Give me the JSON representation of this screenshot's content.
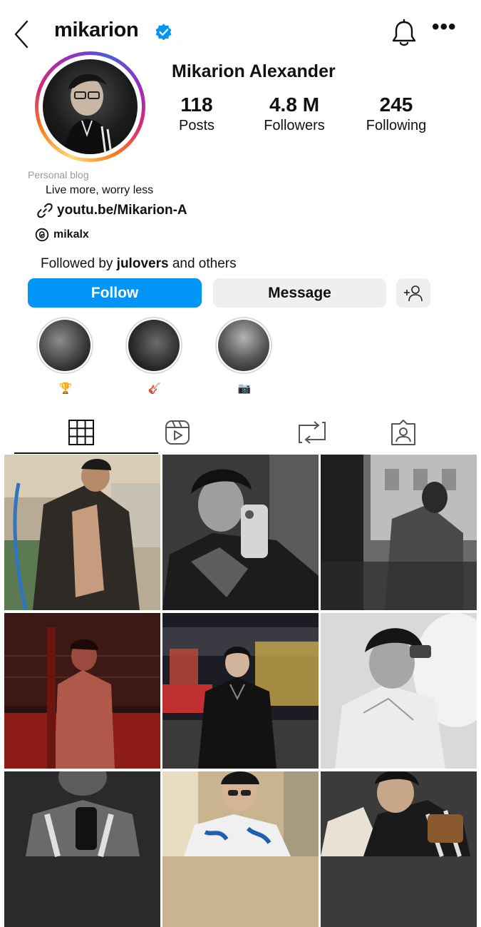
{
  "header": {
    "username": "mikarion",
    "icons": [
      "back-chevron-icon",
      "verified-badge-icon",
      "bell-icon",
      "more-icon"
    ],
    "more_glyph": "•••"
  },
  "profile": {
    "full_name": "Mikarion Alexander",
    "stats": [
      {
        "value": "118",
        "label": "Posts"
      },
      {
        "value": "4.8 M",
        "label": "Followers"
      },
      {
        "value": "245",
        "label": "Following"
      }
    ],
    "category": "Personal blog",
    "bio": "Live more, worry less",
    "link": "youtu.be/Mikarion-A",
    "threads_handle": "mikalx",
    "followed_by": {
      "prefix": "Followed by ",
      "name": "julovers",
      "suffix": " and others"
    }
  },
  "actions": {
    "follow_label": "Follow",
    "message_label": "Message",
    "add_person_icon": "add-person-icon"
  },
  "highlights": [
    {
      "label": "🏆",
      "icon": "trophy-emoji"
    },
    {
      "label": "🎸",
      "icon": "guitar-emoji"
    },
    {
      "label": "📷",
      "icon": "camera-emoji"
    }
  ],
  "tabs": [
    {
      "icon": "grid-icon",
      "active": true
    },
    {
      "icon": "reels-icon",
      "active": false
    },
    {
      "icon": "reposts-icon",
      "active": false
    },
    {
      "icon": "tagged-icon",
      "active": false
    }
  ],
  "colors": {
    "accent": "#0095f6",
    "verified": "#0095f6",
    "secondary_button": "#efefef"
  }
}
